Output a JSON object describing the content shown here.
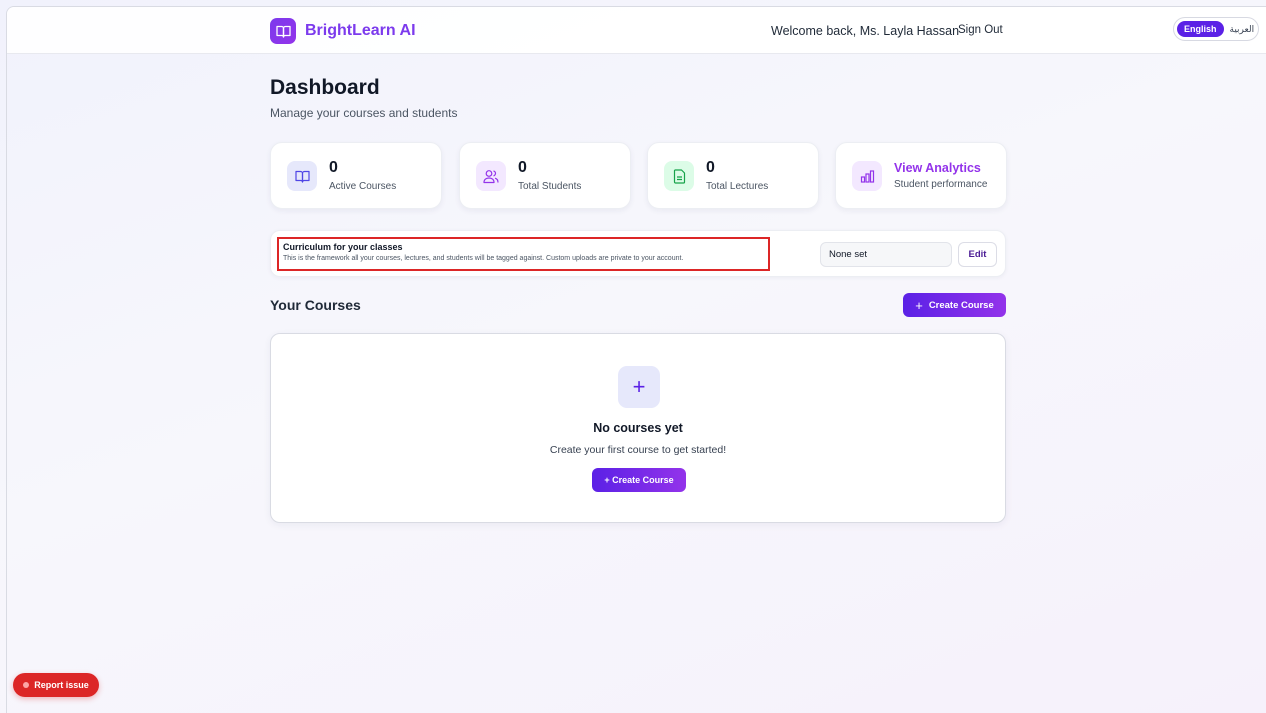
{
  "header": {
    "brand": "BrightLearn AI",
    "welcome": "Welcome back, Ms. Layla Hassan",
    "sign_out": "Sign Out",
    "lang_en": "English",
    "lang_ar": "العربية"
  },
  "page": {
    "title": "Dashboard",
    "subtitle": "Manage your courses and students"
  },
  "stats": [
    {
      "value": "0",
      "label": "Active Courses",
      "icon": "book-icon",
      "color": "#e6e8fb"
    },
    {
      "value": "0",
      "label": "Total Students",
      "icon": "users-icon",
      "color": "#f3e8ff"
    },
    {
      "value": "0",
      "label": "Total Lectures",
      "icon": "document-icon",
      "color": "#dcfce7"
    }
  ],
  "analytics": {
    "title": "View Analytics",
    "subtitle": "Student performance",
    "icon": "bar-chart-icon"
  },
  "curriculum": {
    "title": "Curriculum for your classes",
    "description": "This is the framework all your courses, lectures, and students will be tagged against. Custom uploads are private to your account.",
    "value": "None set",
    "edit": "Edit"
  },
  "courses": {
    "heading": "Your Courses",
    "create_label": "Create Course",
    "empty_title": "No courses yet",
    "empty_desc": "Create your first course to get started!",
    "empty_button": "+ Create Course"
  },
  "report": {
    "label": "Report issue"
  },
  "colors": {
    "accent": "#7c3aed",
    "primary": "#5b21e6",
    "danger": "#dc2626"
  }
}
